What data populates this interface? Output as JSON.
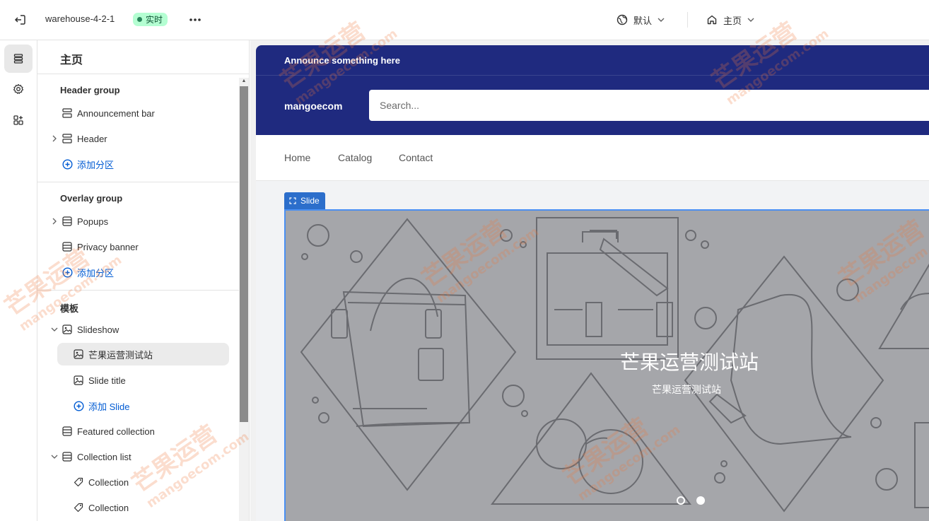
{
  "topbar": {
    "theme_name": "warehouse-4-2-1",
    "live_badge": "实时",
    "more_label": "•••",
    "locale_dropdown": "默认",
    "page_dropdown": "主页"
  },
  "panel": {
    "title": "主页",
    "groups": [
      {
        "title": "Header group",
        "items": [
          {
            "label": "Announcement bar",
            "icon": "section-icon"
          },
          {
            "label": "Header",
            "icon": "section-icon",
            "expandable": true
          },
          {
            "label": "添加分区",
            "icon": "plus-circle-icon",
            "add": true
          }
        ]
      },
      {
        "title": "Overlay group",
        "items": [
          {
            "label": "Popups",
            "icon": "section-icon",
            "expandable": true
          },
          {
            "label": "Privacy banner",
            "icon": "section-icon"
          },
          {
            "label": "添加分区",
            "icon": "plus-circle-icon",
            "add": true
          }
        ]
      },
      {
        "title": "模板",
        "items": [
          {
            "label": "Slideshow",
            "icon": "slideshow-icon",
            "expanded": true
          },
          {
            "label": "芒果运营测试站",
            "icon": "image-icon",
            "selected": true
          },
          {
            "label": "Slide title",
            "icon": "image-icon"
          },
          {
            "label": "添加 Slide",
            "icon": "plus-circle-icon",
            "add": true
          },
          {
            "label": "Featured collection",
            "icon": "section-icon"
          },
          {
            "label": "Collection list",
            "icon": "section-icon",
            "expanded": true
          },
          {
            "label": "Collection",
            "icon": "tag-icon"
          },
          {
            "label": "Collection",
            "icon": "tag-icon"
          }
        ]
      }
    ]
  },
  "preview": {
    "announcement": "Announce something here",
    "logo": "mangoecom",
    "search_placeholder": "Search...",
    "nav": [
      "Home",
      "Catalog",
      "Contact"
    ],
    "slide_tag": "Slide",
    "slide_heading": "芒果运营测试站",
    "slide_subheading": "芒果运营测试站",
    "slide_count": 2,
    "active_slide": 1
  },
  "watermark": {
    "text": "芒果运营",
    "domain": "mangoecom.com"
  },
  "colors": {
    "announce_bg": "#1f2a7f",
    "accent_blue": "#2c6ecb",
    "link_blue": "#005bd3",
    "badge_bg": "#b4fed2",
    "slide_bg": "#a5a6aa"
  }
}
